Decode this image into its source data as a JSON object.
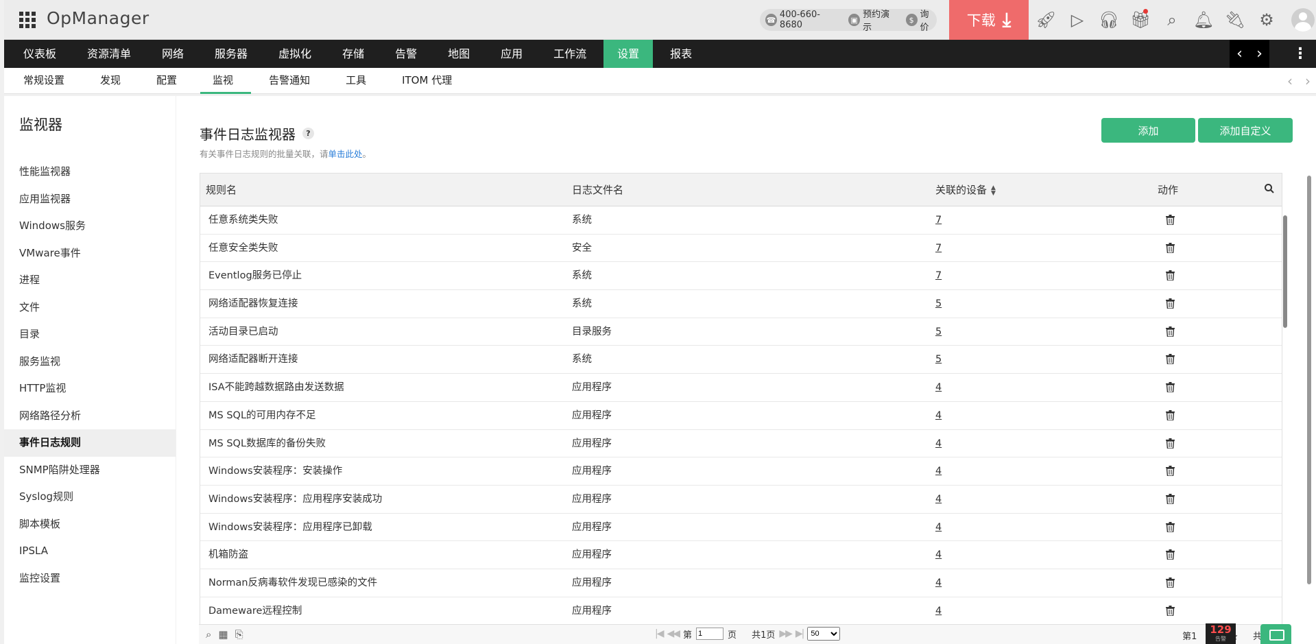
{
  "app": {
    "brand": "OpManager",
    "contact": {
      "phone": "400-660-8680",
      "demo": "预约演示",
      "quote": "询价"
    },
    "download_label": "下载"
  },
  "top_icons": [
    "rocket-icon",
    "presentation-icon",
    "headset-icon",
    "gift-icon",
    "search-icon",
    "bell-icon",
    "plug-icon",
    "gear-icon"
  ],
  "main_nav": [
    {
      "label": "仪表板",
      "active": false
    },
    {
      "label": "资源清单",
      "active": false
    },
    {
      "label": "网络",
      "active": false
    },
    {
      "label": "服务器",
      "active": false
    },
    {
      "label": "虚拟化",
      "active": false
    },
    {
      "label": "存储",
      "active": false
    },
    {
      "label": "告警",
      "active": false
    },
    {
      "label": "地图",
      "active": false
    },
    {
      "label": "应用",
      "active": false
    },
    {
      "label": "工作流",
      "active": false
    },
    {
      "label": "设置",
      "active": true
    },
    {
      "label": "报表",
      "active": false
    }
  ],
  "sub_nav": [
    {
      "label": "常规设置",
      "active": false
    },
    {
      "label": "发现",
      "active": false
    },
    {
      "label": "配置",
      "active": false
    },
    {
      "label": "监视",
      "active": true
    },
    {
      "label": "告警通知",
      "active": false
    },
    {
      "label": "工具",
      "active": false
    },
    {
      "label": "ITOM 代理",
      "active": false
    }
  ],
  "sidebar": {
    "title": "监视器",
    "items": [
      {
        "label": "性能监视器",
        "active": false
      },
      {
        "label": "应用监视器",
        "active": false
      },
      {
        "label": "Windows服务",
        "active": false
      },
      {
        "label": "VMware事件",
        "active": false
      },
      {
        "label": "进程",
        "active": false
      },
      {
        "label": "文件",
        "active": false
      },
      {
        "label": "目录",
        "active": false
      },
      {
        "label": "服务监视",
        "active": false
      },
      {
        "label": "HTTP监视",
        "active": false
      },
      {
        "label": "网络路径分析",
        "active": false
      },
      {
        "label": "事件日志规则",
        "active": true
      },
      {
        "label": "SNMP陷阱处理器",
        "active": false
      },
      {
        "label": "Syslog规则",
        "active": false
      },
      {
        "label": "脚本模板",
        "active": false
      },
      {
        "label": "IPSLA",
        "active": false
      },
      {
        "label": "监控设置",
        "active": false
      }
    ]
  },
  "page": {
    "title": "事件日志监视器",
    "help": "?",
    "subtitle_prefix": "有关事件日志规则的批量关联，请",
    "subtitle_link": "单击此处",
    "subtitle_suffix": "。",
    "add_label": "添加",
    "add_custom_label": "添加自定义"
  },
  "table": {
    "columns": [
      "规则名",
      "日志文件名",
      "关联的设备",
      "动作"
    ],
    "rows": [
      {
        "rule": "任意系统类失败",
        "log": "系统",
        "devices": "7"
      },
      {
        "rule": "任意安全类失败",
        "log": "安全",
        "devices": "7"
      },
      {
        "rule": "Eventlog服务已停止",
        "log": "系统",
        "devices": "7"
      },
      {
        "rule": "网络适配器恢复连接",
        "log": "系统",
        "devices": "5"
      },
      {
        "rule": "活动目录已启动",
        "log": "目录服务",
        "devices": "5"
      },
      {
        "rule": "网络适配器断开连接",
        "log": "系统",
        "devices": "5"
      },
      {
        "rule": "ISA不能跨越数据路由发送数据",
        "log": "应用程序",
        "devices": "4"
      },
      {
        "rule": "MS SQL的可用内存不足",
        "log": "应用程序",
        "devices": "4"
      },
      {
        "rule": "MS SQL数据库的备份失败",
        "log": "应用程序",
        "devices": "4"
      },
      {
        "rule": "Windows安装程序：安装操作",
        "log": "应用程序",
        "devices": "4"
      },
      {
        "rule": "Windows安装程序：应用程序安装成功",
        "log": "应用程序",
        "devices": "4"
      },
      {
        "rule": "Windows安装程序：应用程序已卸载",
        "log": "应用程序",
        "devices": "4"
      },
      {
        "rule": "机箱防盗",
        "log": "应用程序",
        "devices": "4"
      },
      {
        "rule": "Norman反病毒软件发现已感染的文件",
        "log": "应用程序",
        "devices": "4"
      },
      {
        "rule": "Dameware远程控制",
        "log": "应用程序",
        "devices": "4"
      }
    ]
  },
  "pager": {
    "page_prefix": "第",
    "page_value": "1",
    "page_suffix": "页",
    "total_pages": "共1页",
    "page_size": "50",
    "right_text": "第1",
    "right_text2": "条",
    "right_text3": "共",
    "alarm_count": "129",
    "alarm_label": "告警"
  },
  "colors": {
    "accent": "#3bb77e",
    "download": "#ef6b6b",
    "nav_bg": "#1f1f1f",
    "link": "#2a7ed8"
  }
}
